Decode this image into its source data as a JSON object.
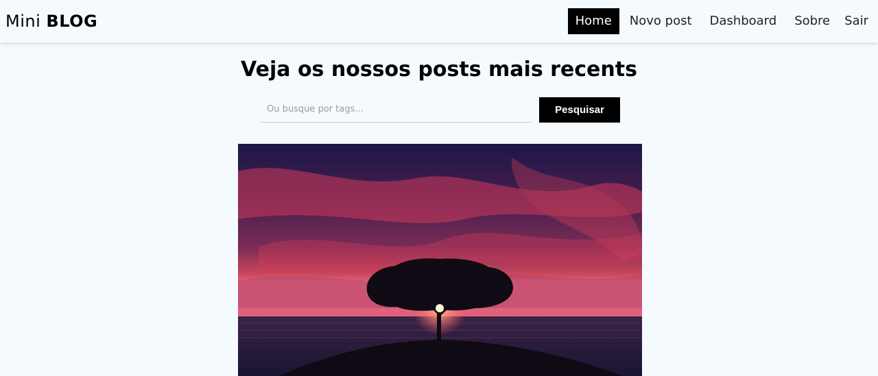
{
  "brand": {
    "light": "Mini",
    "bold": "BLOG"
  },
  "nav": {
    "items": [
      {
        "label": "Home"
      },
      {
        "label": "Novo post"
      },
      {
        "label": "Dashboard"
      },
      {
        "label": "Sobre"
      }
    ],
    "logout_label": "Sair"
  },
  "home": {
    "title": "Veja os nossos posts mais recents",
    "search": {
      "placeholder": "Ou busque por tags...",
      "value": "",
      "button_label": "Pesquisar"
    }
  },
  "post": {
    "image_icon": "sunset-tree-photo"
  },
  "colors": {
    "background": "#f5faff",
    "active_nav": "#000000",
    "button": "#000000"
  }
}
